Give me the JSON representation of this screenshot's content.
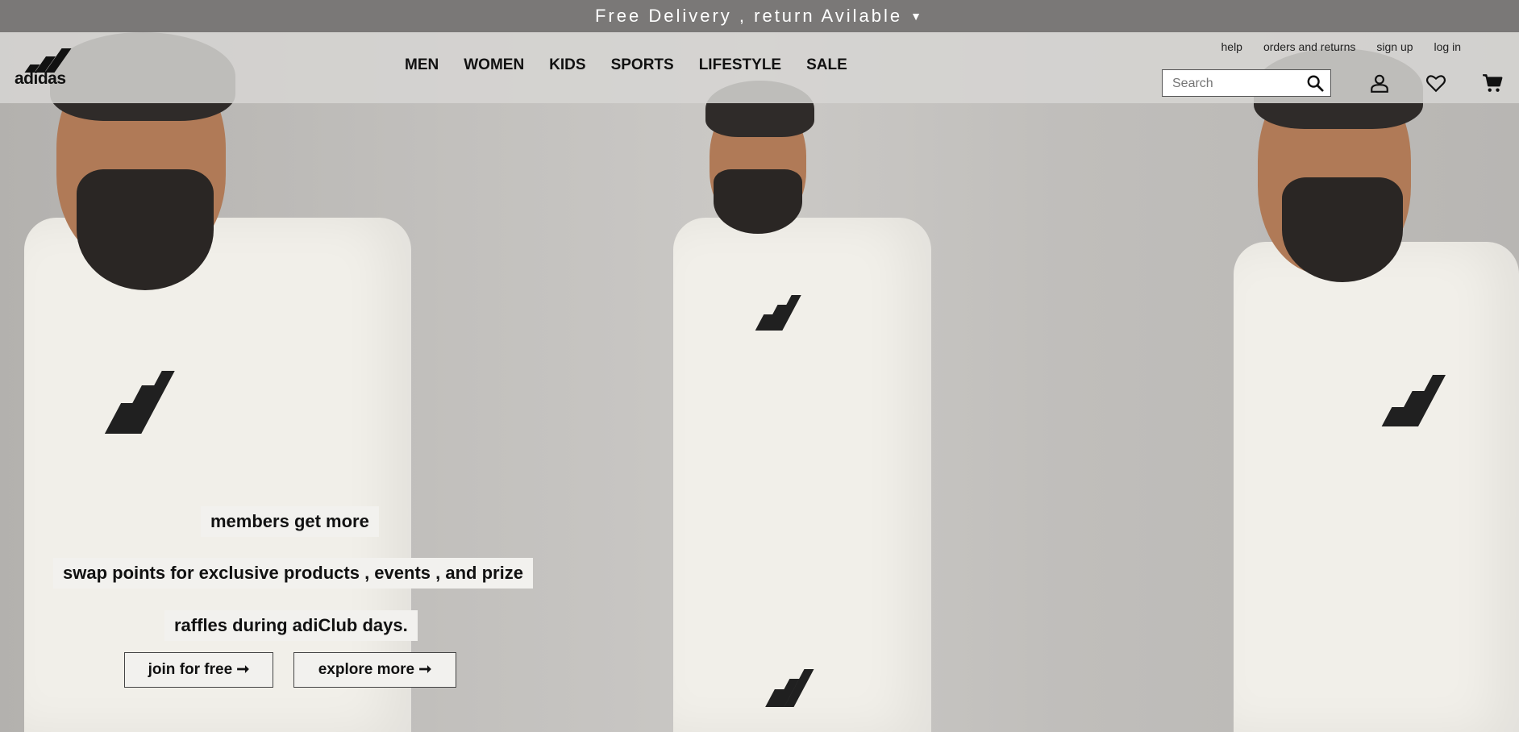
{
  "announcement": {
    "text": "Free Delivery , return Avilable",
    "caret_icon": "caret-down-icon"
  },
  "brand": {
    "logo_text": "adidas"
  },
  "nav": {
    "menu": [
      "MEN",
      "WOMEN",
      "KIDS",
      "SPORTS",
      "LIFESTYLE",
      "SALE"
    ],
    "utility_links": [
      "help",
      "orders and returns",
      "sign up",
      "log in"
    ],
    "search_placeholder": "Search",
    "icons": [
      "search-icon",
      "user-icon",
      "heart-icon",
      "cart-icon"
    ]
  },
  "promo": {
    "line1": "members get more",
    "line2": "swap points for exclusive products , events , and prize",
    "line3": "raffles during adiClub days.",
    "join_button": "join for free ➞",
    "explore_button": "explore more ➞"
  },
  "colors": {
    "topbar_bg": "#7a7877",
    "nav_bg": "#d6d5d3",
    "text": "#111111"
  }
}
